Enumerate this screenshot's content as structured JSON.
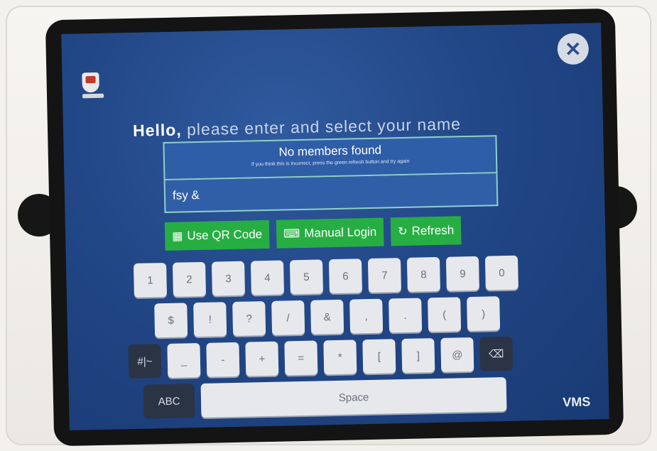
{
  "greeting": {
    "hello": "Hello,",
    "prompt": "please enter and select your name"
  },
  "status": {
    "title": "No members found",
    "subtitle": "If you think this is incorrect, press the green refresh button and try again"
  },
  "search": {
    "value": "fsy &"
  },
  "actions": {
    "qr": {
      "label": "Use QR Code",
      "icon": "qr-icon"
    },
    "manual": {
      "label": "Manual Login",
      "icon": "keyboard-icon"
    },
    "refresh": {
      "label": "Refresh",
      "icon": "refresh-icon"
    }
  },
  "keyboard": {
    "row1": [
      "1",
      "2",
      "3",
      "4",
      "5",
      "6",
      "7",
      "8",
      "9",
      "0"
    ],
    "row2": [
      "$",
      "!",
      "?",
      "/",
      "&",
      ",",
      ".",
      "(",
      ")"
    ],
    "row3_left": "#|~",
    "row3": [
      "_",
      "-",
      "+",
      "=",
      "*",
      "[",
      "]",
      "@"
    ],
    "abc": "ABC",
    "space": "Space",
    "backspace_icon": "backspace-icon"
  },
  "brand": {
    "vms": "VMS"
  },
  "colors": {
    "accent_green": "#27ae43",
    "screen_blue": "#224787",
    "border_teal": "#8fd0c7"
  }
}
